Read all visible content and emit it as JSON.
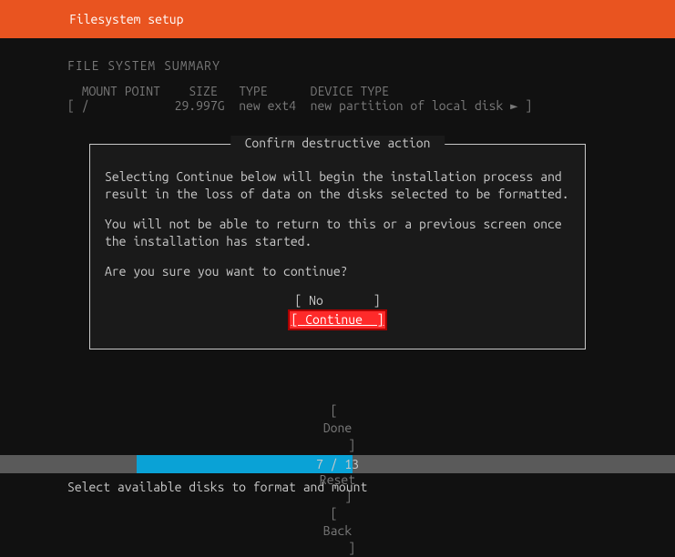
{
  "header": {
    "title": "Filesystem setup"
  },
  "summary": {
    "title": "FILE SYSTEM SUMMARY",
    "columns": {
      "mount": "MOUNT POINT",
      "size": "SIZE",
      "type": "TYPE",
      "device": "DEVICE TYPE"
    },
    "rows": [
      {
        "mount": "/",
        "size": "29.997G",
        "type": "new ext4",
        "device": "new partition of local disk",
        "arrow": "►"
      }
    ]
  },
  "dialog": {
    "title": "Confirm destructive action",
    "para1": "Selecting Continue below will begin the installation process and result in the loss of data on the disks selected to be formatted.",
    "para2": "You will not be able to return to this or a previous screen once the installation has started.",
    "para3": "Are you sure you want to continue?",
    "no_label": "No",
    "continue_label": "Continue"
  },
  "footer_actions": {
    "done": "Done",
    "reset": "Reset",
    "back": "Back"
  },
  "progress": {
    "current": 7,
    "total": 13,
    "text": "7 / 13"
  },
  "footer_hint": "Select available disks to format and mount"
}
